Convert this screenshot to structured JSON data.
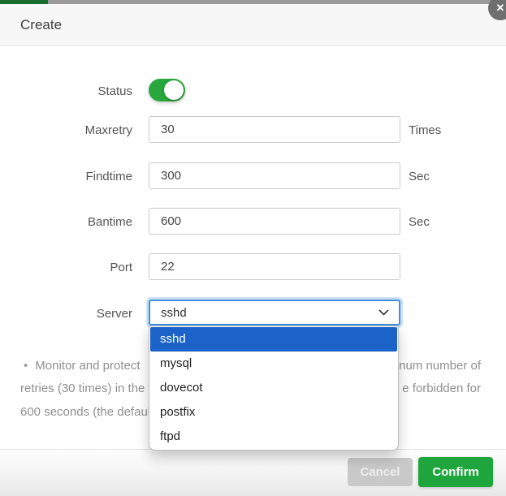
{
  "dialog": {
    "title": "Create",
    "close_glyph": "✕"
  },
  "form": {
    "status": {
      "label": "Status",
      "state": "on"
    },
    "maxretry": {
      "label": "Maxretry",
      "value": "30",
      "unit": "Times"
    },
    "findtime": {
      "label": "Findtime",
      "value": "300",
      "unit": "Sec"
    },
    "bantime": {
      "label": "Bantime",
      "value": "600",
      "unit": "Sec"
    },
    "port": {
      "label": "Port",
      "value": "22"
    },
    "server": {
      "label": "Server",
      "value": "sshd",
      "selected_option": "sshd",
      "options": [
        "sshd",
        "mysql",
        "dovecot",
        "postfix",
        "ftpd"
      ]
    }
  },
  "help": {
    "bullet": "•",
    "line1_left": "Monitor and protect",
    "line1_right": "num number of",
    "line2_left": "retries (30 times) in the",
    "line2_right": "e forbidden for",
    "line3_left": "600 seconds (the defaul"
  },
  "footer": {
    "cancel_label": "Cancel",
    "confirm_label": "Confirm"
  },
  "colors": {
    "top_strip_green": "#186c2d",
    "top_strip_gray": "#9a9a9a",
    "accent_green": "#1ea53c",
    "toggle_green": "#28a73c",
    "dropdown_highlight_blue": "#1b63c8",
    "focus_border_blue": "#4090dc",
    "cancel_gray": "#c9c9c9"
  }
}
